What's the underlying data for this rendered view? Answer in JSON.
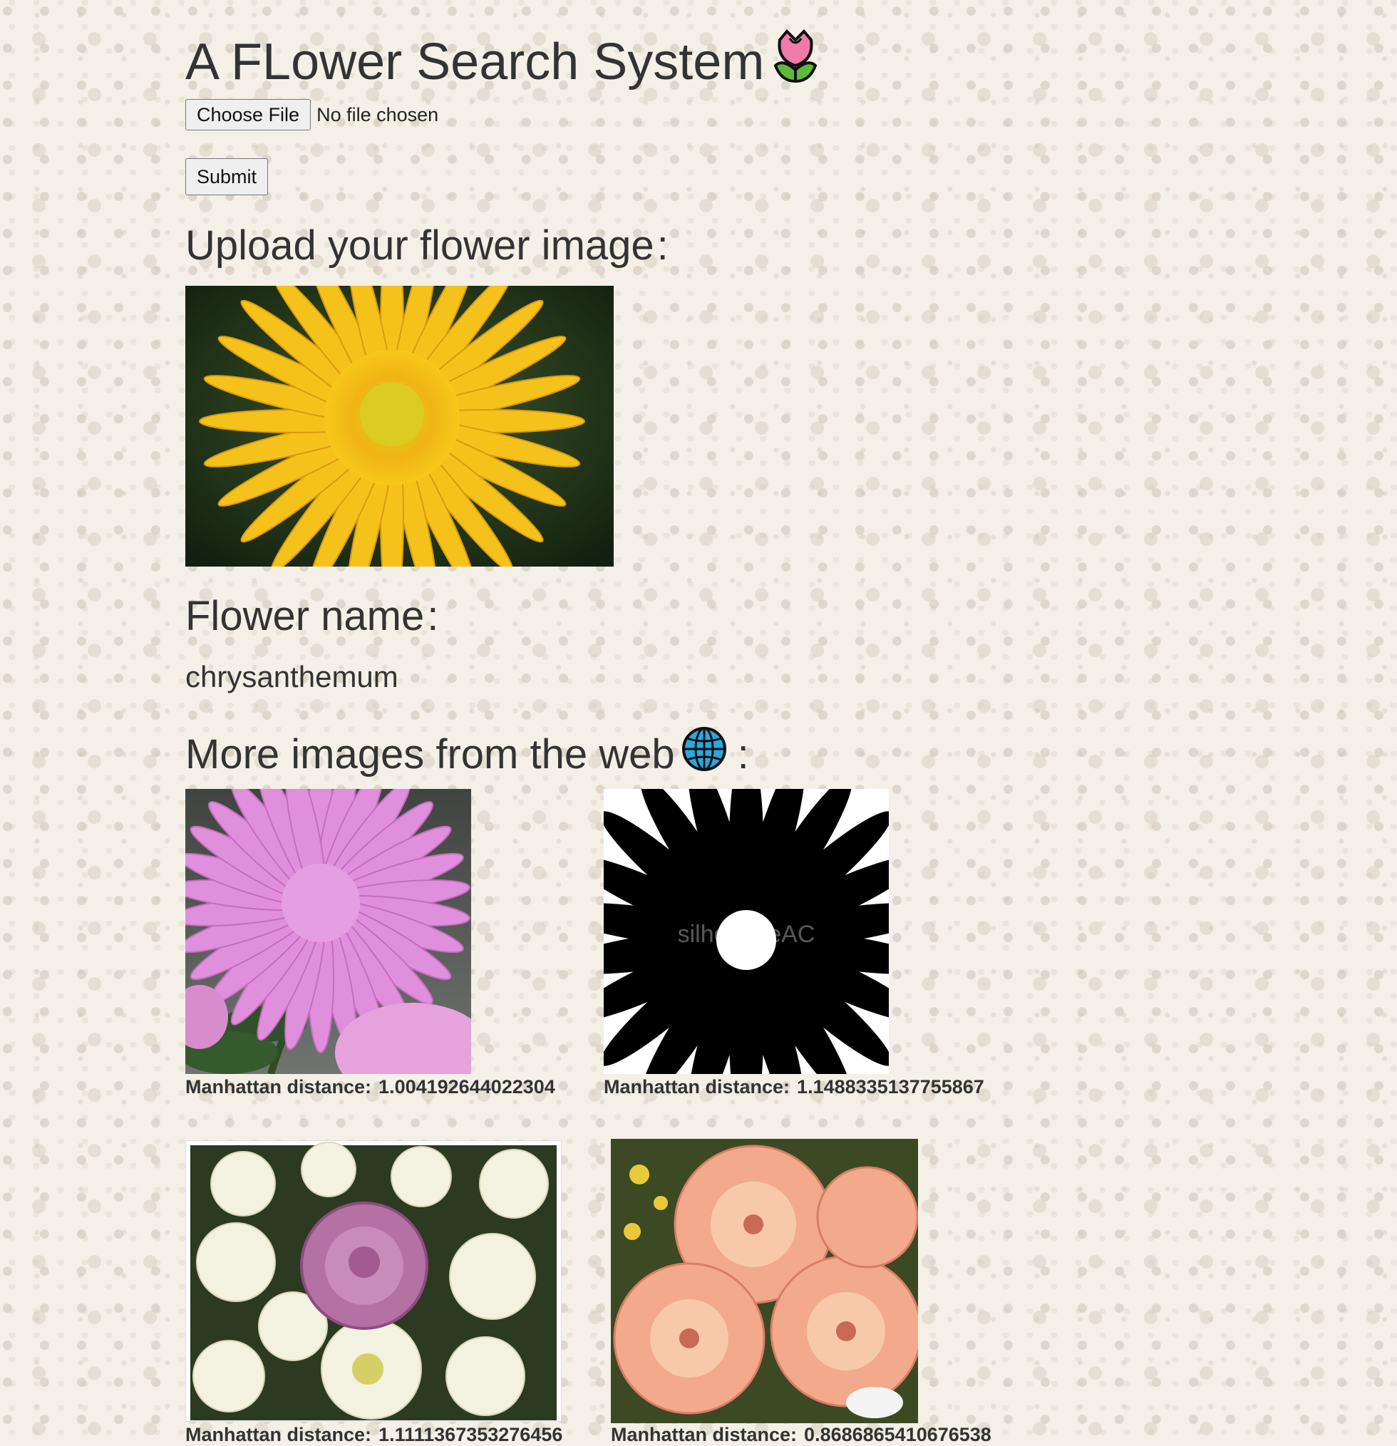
{
  "header": {
    "title": "A FLower Search System",
    "title_icon": "tulip-emoji"
  },
  "form": {
    "choose_file_label": "Choose File",
    "file_status": "No file chosen",
    "submit_label": "Submit"
  },
  "upload": {
    "heading": "Upload your flower image",
    "separator": ":"
  },
  "result": {
    "heading": "Flower name",
    "separator": ":",
    "flower_name": "chrysanthemum"
  },
  "web": {
    "heading": "More images from the web",
    "heading_icon": "globe-emoji",
    "separator": ":",
    "images": [
      {
        "label": "Manhattan distance:",
        "value": "1.004192644022304"
      },
      {
        "label": "Manhattan distance:",
        "value": "1.1488335137755867",
        "watermark": "silhouetteAC"
      },
      {
        "label": "Manhattan distance:",
        "value": "1.1111367353276456"
      },
      {
        "label": "Manhattan distance:",
        "value": "0.8686865410676538"
      }
    ]
  },
  "colors": {
    "background": "#f4f0e8",
    "text": "#333333",
    "tulip_pink": "#f07aa8",
    "globe_blue": "#2aa8e0"
  }
}
